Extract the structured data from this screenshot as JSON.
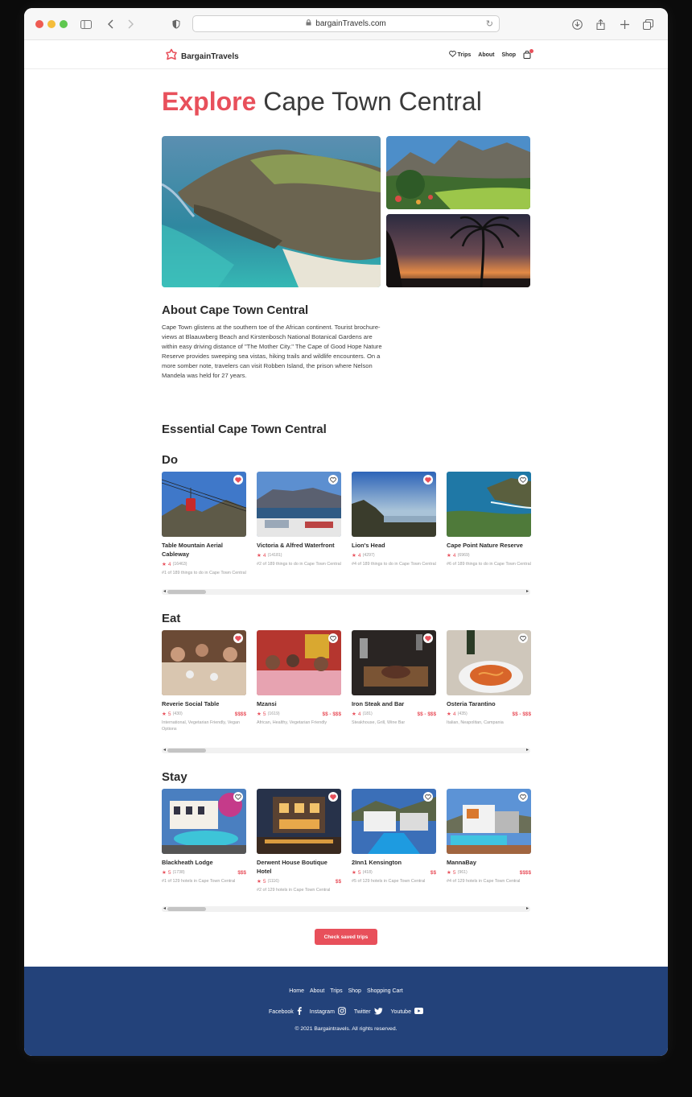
{
  "browser": {
    "url": "bargainTravels.com"
  },
  "header": {
    "brand": "BargainTravels",
    "nav": [
      "Trips",
      "About",
      "Shop"
    ]
  },
  "page": {
    "title_accent": "Explore",
    "title_rest": "Cape Town Central",
    "about_title": "About Cape Town Central",
    "about_text": "Cape Town glistens at the southern toe of the African continent. Tourist brochure-views at Blaauwberg Beach and Kirstenbosch National Botanical Gardens are within easy driving distance of \"The Mother City.\" The Cape of Good Hope Nature Reserve provides sweeping sea vistas, hiking trails and wildlife encounters. On a more somber note, travelers can visit Robben Island, the prison where Nelson Mandela was held for 27 years.",
    "essential_title": "Essential Cape Town Central",
    "cta": "Check saved trips"
  },
  "sections": {
    "do": {
      "label": "Do",
      "items": [
        {
          "name": "Table Mountain Aerial Cableway",
          "rating": "4",
          "reviews": "(16463)",
          "sub": "#1 of 189 things to do in Cape Town Central",
          "fav": true
        },
        {
          "name": "Victoria & Alfred Waterfront",
          "rating": "4",
          "reviews": "(14181)",
          "sub": "#2 of 189 things to do in Cape Town Central",
          "fav": false
        },
        {
          "name": "Lion's Head",
          "rating": "4",
          "reviews": "(4297)",
          "sub": "#4 of 189 things to do in Cape Town Central",
          "fav": true
        },
        {
          "name": "Cape Point Nature Reserve",
          "rating": "4",
          "reviews": "(6969)",
          "sub": "#6 of 189 things to do in Cape Town Central",
          "fav": false
        }
      ]
    },
    "eat": {
      "label": "Eat",
      "items": [
        {
          "name": "Reverie Social Table",
          "rating": "5",
          "reviews": "(430)",
          "price": "$$$$",
          "sub": "International, Vegetarian Friendly, Vegan Options",
          "fav": true
        },
        {
          "name": "Mzansi",
          "rating": "5",
          "reviews": "(1619)",
          "price": "$$ - $$$",
          "sub": "African, Healthy, Vegetarian Friendly",
          "fav": false
        },
        {
          "name": "Iron Steak and Bar",
          "rating": "4",
          "reviews": "(181)",
          "price": "$$ - $$$",
          "sub": "Steakhouse, Grill, Wine Bar",
          "fav": true
        },
        {
          "name": "Osteria Tarantino",
          "rating": "4",
          "reviews": "(435)",
          "price": "$$ - $$$",
          "sub": "Italian, Neapolitan, Campania",
          "fav": false
        }
      ]
    },
    "stay": {
      "label": "Stay",
      "items": [
        {
          "name": "Blackheath Lodge",
          "rating": "5",
          "reviews": "(1738)",
          "price": "$$$",
          "sub": "#1 of 129 hotels in Cape Town Central",
          "fav": false
        },
        {
          "name": "Derwent House Boutique Hotel",
          "rating": "5",
          "reviews": "(1116)",
          "price": "$$",
          "sub": "#2 of 129 hotels in Cape Town Central",
          "fav": true
        },
        {
          "name": "2Inn1 Kensington",
          "rating": "5",
          "reviews": "(418)",
          "price": "$$",
          "sub": "#5 of 129 hotels in Cape Town Central",
          "fav": false
        },
        {
          "name": "MannaBay",
          "rating": "5",
          "reviews": "(961)",
          "price": "$$$$",
          "sub": "#4 of 129 hotels in Cape Town Central",
          "fav": false
        }
      ]
    }
  },
  "footer": {
    "links": [
      "Home",
      "About",
      "Trips",
      "Shop",
      "Shopping Cart"
    ],
    "social": [
      "Facebook",
      "Instagram",
      "Twitter",
      "Youtube"
    ],
    "copyright": "© 2021 Bargaintravels. All rights reserved."
  },
  "colors": {
    "accent": "#e8505b",
    "footer": "#23427a"
  }
}
